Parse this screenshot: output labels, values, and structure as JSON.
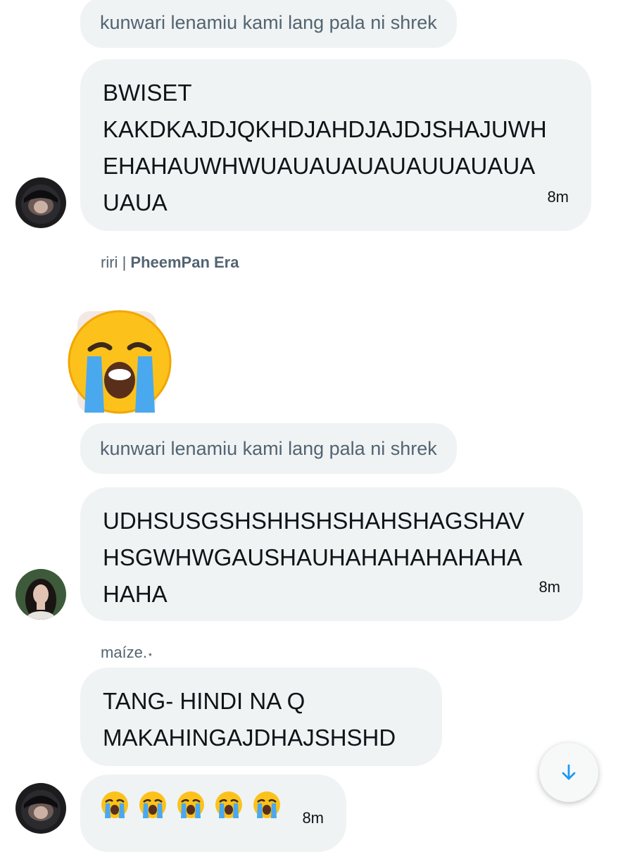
{
  "thread": {
    "reply_preview_1": "kunwari lenamiu kami lang pala ni shrek",
    "message_1": {
      "text": "BWISET\nKAKDKAJDJQKHDJAHDJAJDJSHAJUWH\nEHAHAUWHWUAUAUAUAUAUUAUAUA\nUAUA",
      "time": "8m"
    },
    "sender_2": {
      "name": "riri",
      "separator": "|",
      "bold_suffix": "PheemPan Era"
    },
    "reply_preview_2": "kunwari lenamiu kami lang pala ni shrek",
    "message_2": {
      "text": "UDHSUSGSHSHHSHSHAHSHAGSHAV\nHSGWHWGAUSHAUHAHAHAHAHAHA\nHAHA",
      "time": "8m"
    },
    "sender_3": {
      "name": "maíze.",
      "mark": "⋆"
    },
    "message_3": {
      "text": "TANG- HINDI NA Q\nMAKAHINGAJDHAJSHSHD"
    },
    "message_4": {
      "emoji_count": 5,
      "time": "8m"
    }
  },
  "colors": {
    "bubble": "#eff3f4",
    "muted_text": "#536471",
    "text": "#0f1419",
    "accent": "#1d9bf0"
  },
  "icons": {
    "scroll_down": "arrow-down-icon",
    "big_emoji": "loudly-crying-face-icon",
    "small_emoji": "loudly-crying-face-icon"
  }
}
